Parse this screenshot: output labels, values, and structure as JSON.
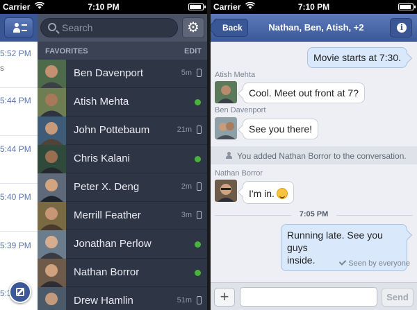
{
  "status": {
    "carrier": "Carrier",
    "time": "7:10 PM"
  },
  "left": {
    "search_placeholder": "Search",
    "favorites_header": "FAVORITES",
    "edit_label": "EDIT",
    "behind_times": [
      "5:52 PM",
      "5:44 PM",
      "5:44 PM",
      "5:40 PM",
      "5:39 PM",
      "5:37 PM"
    ],
    "behind_snippet": "s",
    "favorites": [
      {
        "name": "Ben Davenport",
        "ago": "5m",
        "state": "mobile"
      },
      {
        "name": "Atish Mehta",
        "ago": "",
        "state": "online"
      },
      {
        "name": "John Pottebaum",
        "ago": "21m",
        "state": "mobile"
      },
      {
        "name": "Chris Kalani",
        "ago": "",
        "state": "online"
      },
      {
        "name": "Peter X. Deng",
        "ago": "2m",
        "state": "mobile"
      },
      {
        "name": "Merrill Feather",
        "ago": "3m",
        "state": "mobile"
      },
      {
        "name": "Jonathan Perlow",
        "ago": "",
        "state": "online"
      },
      {
        "name": "Nathan Borror",
        "ago": "",
        "state": "online"
      },
      {
        "name": "Drew Hamlin",
        "ago": "51m",
        "state": "mobile"
      }
    ]
  },
  "right": {
    "back_label": "Back",
    "title": "Nathan, Ben, Atish, +2",
    "messages": {
      "m1": "Movie starts at 7:30.",
      "sender1": "Atish Mehta",
      "m2": "Cool. Meet out front at 7?",
      "sender2": "Ben Davenport",
      "m3": "See you there!",
      "system": "You added Nathan Borror to the conversation.",
      "sender3": "Nathan Borror",
      "m4": "I'm in.",
      "time_header": "7:05 PM",
      "m5_line1": "Running late. See you guys",
      "m5_line2": "inside.",
      "seen": "Seen by everyone"
    },
    "send_label": "Send",
    "add_label": "+"
  },
  "colors": {
    "brand": "#3b5998",
    "online": "#49b43c",
    "sidebar": "#2e3544"
  }
}
